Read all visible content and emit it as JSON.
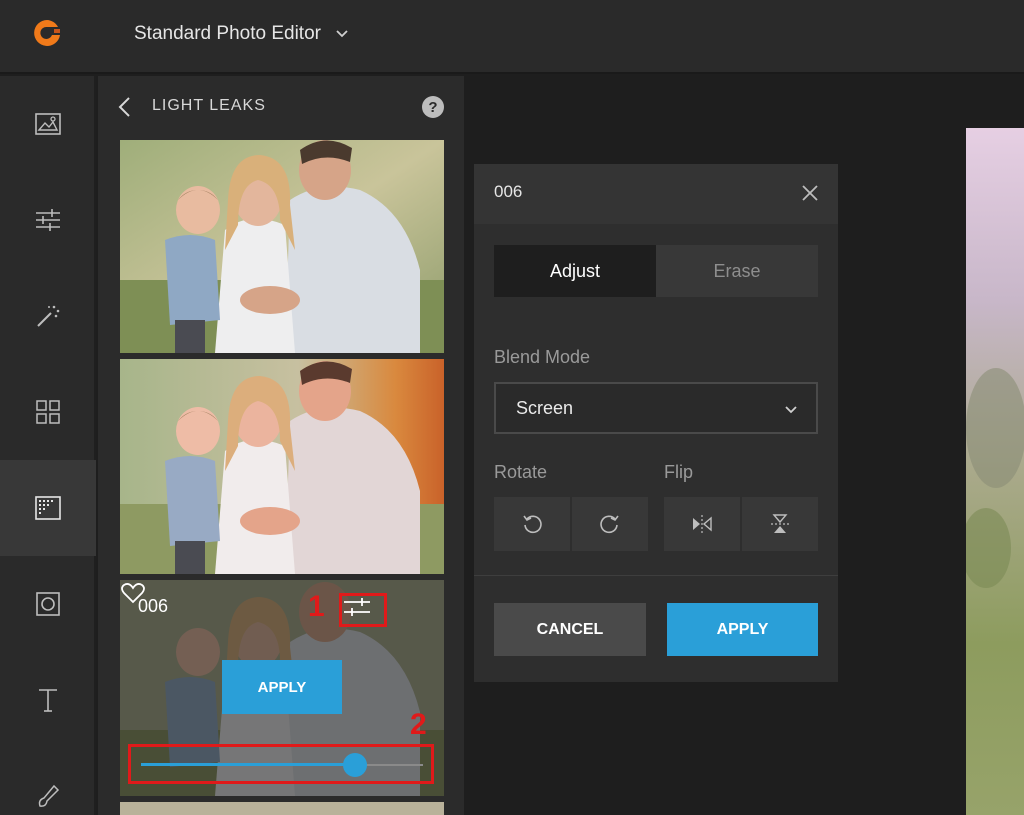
{
  "header": {
    "editor_name": "Standard Photo Editor"
  },
  "panel": {
    "title": "LIGHT LEAKS",
    "help": "?",
    "selected_thumb": {
      "name": "006",
      "apply_label": "APPLY",
      "intensity_percent": 76
    }
  },
  "annotations": {
    "one": "1",
    "two": "2"
  },
  "dialog": {
    "title": "006",
    "tabs": [
      {
        "label": "Adjust"
      },
      {
        "label": "Erase"
      }
    ],
    "blend_mode_label": "Blend Mode",
    "blend_mode_value": "Screen",
    "rotate_label": "Rotate",
    "flip_label": "Flip",
    "cancel_label": "CANCEL",
    "apply_label": "APPLY"
  },
  "colors": {
    "accent": "#2a9fd8",
    "annotation": "#e01a1a",
    "logo": "#f07a1a"
  }
}
